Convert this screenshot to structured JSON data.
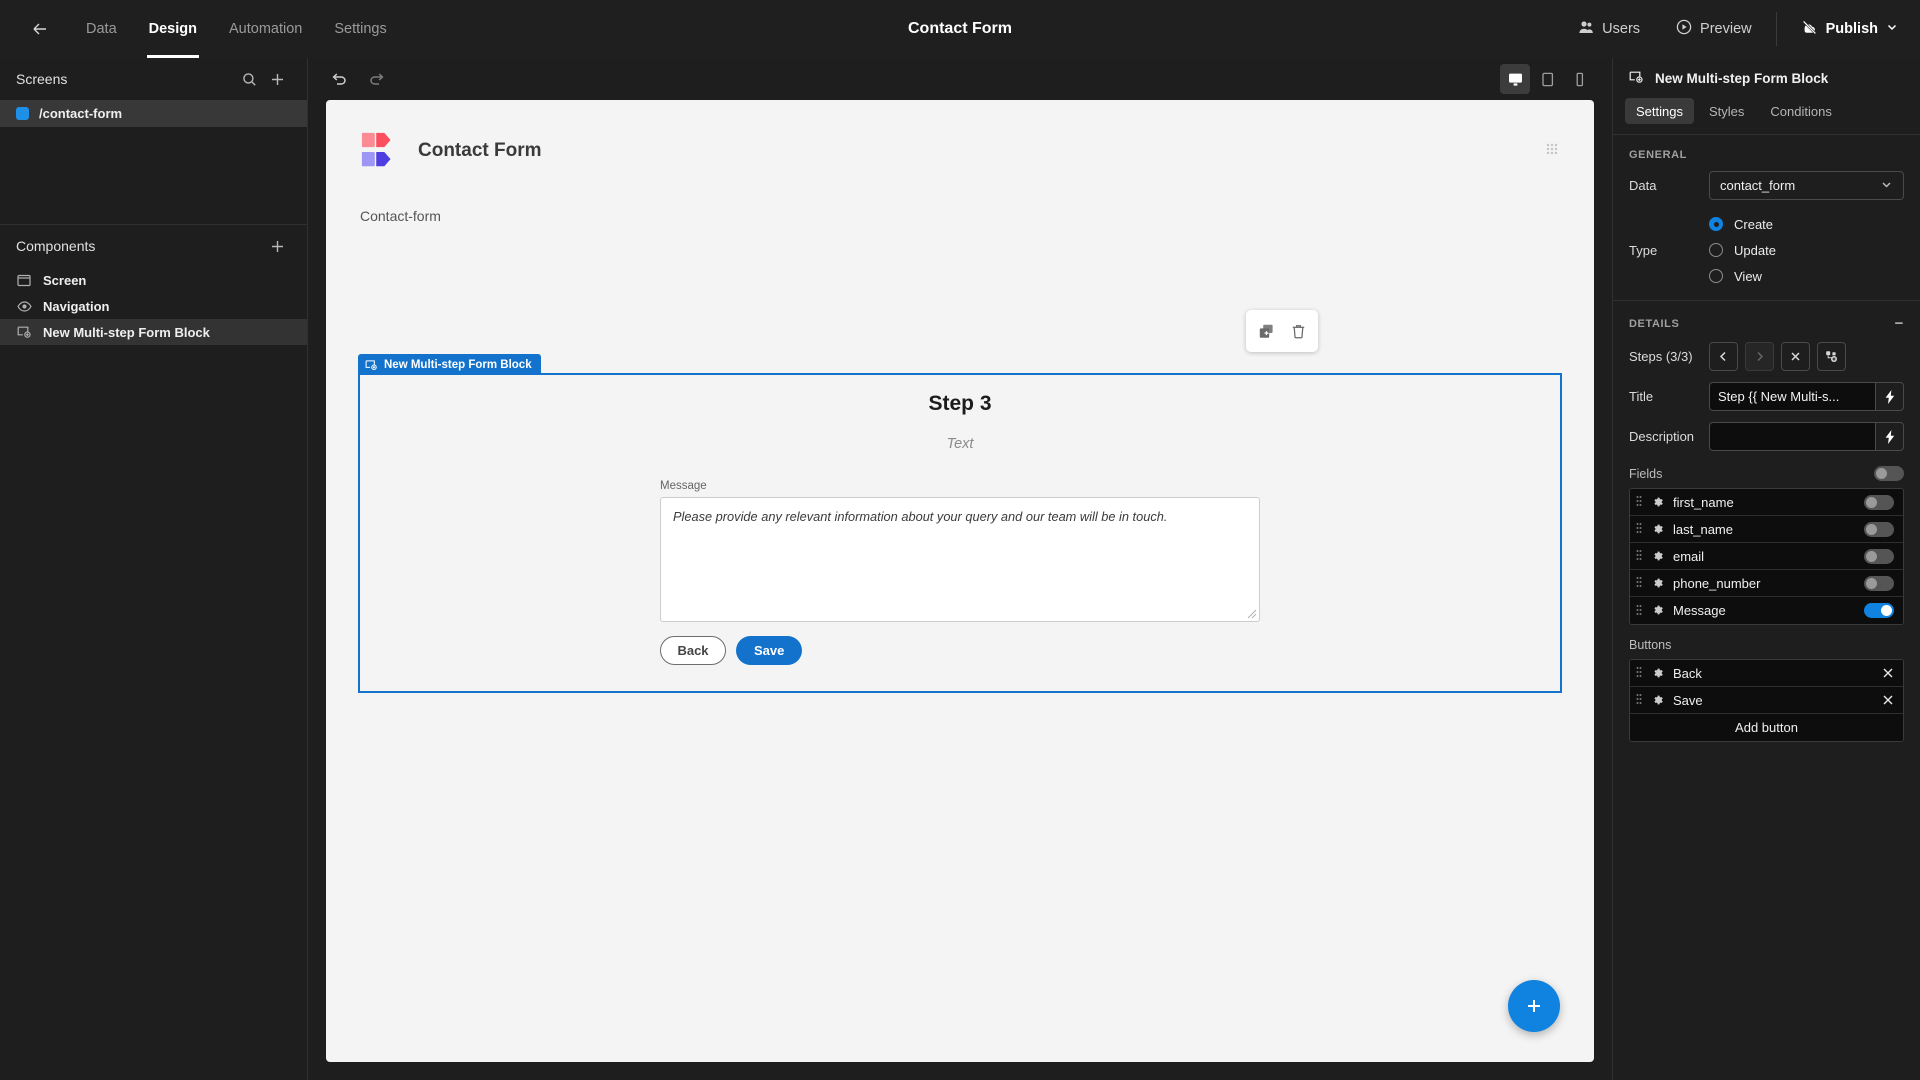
{
  "topbar": {
    "back_icon": "arrow-left-icon",
    "nav": [
      {
        "label": "Data",
        "active": false
      },
      {
        "label": "Design",
        "active": true
      },
      {
        "label": "Automation",
        "active": false
      },
      {
        "label": "Settings",
        "active": false
      }
    ],
    "title": "Contact Form",
    "users_label": "Users",
    "preview_label": "Preview",
    "publish_label": "Publish"
  },
  "left_panel": {
    "screens_title": "Screens",
    "screens": [
      {
        "label": "/contact-form",
        "selected": true
      }
    ],
    "components_title": "Components",
    "components": [
      {
        "label": "Screen",
        "icon": "screen-icon",
        "selected": false
      },
      {
        "label": "Navigation",
        "icon": "navigation-icon",
        "selected": false
      },
      {
        "label": "New Multi-step Form Block",
        "icon": "form-block-icon",
        "selected": true
      }
    ]
  },
  "canvas": {
    "devices": [
      {
        "name": "desktop",
        "active": true
      },
      {
        "name": "tablet",
        "active": false
      },
      {
        "name": "mobile",
        "active": false
      }
    ],
    "form_header_title": "Contact Form",
    "screen_label": "Contact-form",
    "block_tag": "New Multi-step Form Block",
    "step_title": "Step 3",
    "step_text": "Text",
    "message_label": "Message",
    "message_placeholder": "Please provide any relevant information about your query and our team will be in touch.",
    "back_button": "Back",
    "save_button": "Save",
    "logo_colors": {
      "top": "#fb5f6b",
      "top_light": "#fb8a94",
      "bottom": "#4f3fe0",
      "bottom_light": "#9e96f5"
    },
    "accent": "#1373cc"
  },
  "right_panel": {
    "header_title": "New Multi-step Form Block",
    "tabs": [
      {
        "label": "Settings",
        "active": true
      },
      {
        "label": "Styles",
        "active": false
      },
      {
        "label": "Conditions",
        "active": false
      }
    ],
    "general_title": "GENERAL",
    "data_label": "Data",
    "data_value": "contact_form",
    "type_label": "Type",
    "type_options": [
      {
        "label": "Create",
        "selected": true
      },
      {
        "label": "Update",
        "selected": false
      },
      {
        "label": "View",
        "selected": false
      }
    ],
    "details_title": "DETAILS",
    "steps_label": "Steps (3/3)",
    "title_label": "Title",
    "title_value": "Step {{ New Multi-s...",
    "description_label": "Description",
    "description_value": "",
    "fields_label": "Fields",
    "fields_master_toggle": false,
    "fields": [
      {
        "name": "first_name",
        "enabled": false
      },
      {
        "name": "last_name",
        "enabled": false
      },
      {
        "name": "email",
        "enabled": false
      },
      {
        "name": "phone_number",
        "enabled": false
      },
      {
        "name": "Message",
        "enabled": true
      }
    ],
    "buttons_label": "Buttons",
    "buttons": [
      {
        "name": "Back"
      },
      {
        "name": "Save"
      }
    ],
    "add_button_label": "Add button"
  }
}
